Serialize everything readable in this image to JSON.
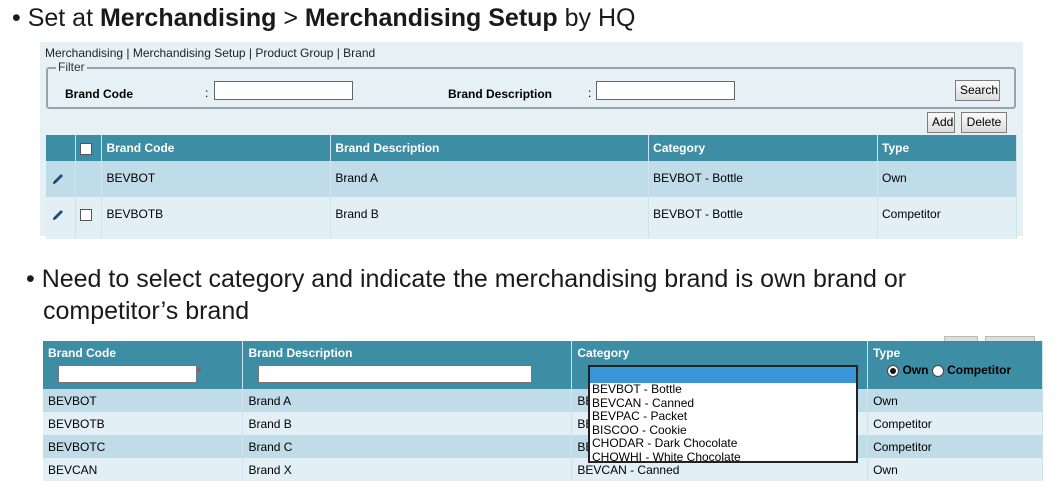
{
  "slide": {
    "bullet1": {
      "prefix": "• Set at ",
      "bold1": "Merchandising",
      "sep": " > ",
      "bold2": "Merchandising Setup",
      "suffix": " by HQ"
    },
    "bullet2_line1": "• Need to select category and indicate the merchandising brand is own brand or",
    "bullet2_line2": "competitor’s brand"
  },
  "screen1": {
    "breadcrumb": "Merchandising | Merchandising Setup | Product Group | Brand",
    "filter": {
      "legend": "Filter",
      "brand_code_label": "Brand Code",
      "brand_desc_label": "Brand Description",
      "colon": ":",
      "brand_code_value": "",
      "brand_desc_value": "",
      "search_label": "Search"
    },
    "actions": {
      "add_label": "Add",
      "delete_label": "Delete"
    },
    "table": {
      "columns": [
        "Brand Code",
        "Brand Description",
        "Category",
        "Type"
      ],
      "rows": [
        {
          "code": "BEVBOT",
          "desc": "Brand A",
          "category": "BEVBOT - Bottle",
          "type": "Own",
          "has_checkbox": false
        },
        {
          "code": "BEVBOTB",
          "desc": "Brand B",
          "category": "BEVBOT - Bottle",
          "type": "Competitor",
          "has_checkbox": true
        }
      ]
    }
  },
  "screen2": {
    "columns": [
      "Brand Code",
      "Brand Description",
      "Category",
      "Type"
    ],
    "type_options": {
      "own": "Own",
      "competitor": "Competitor",
      "selected": "Own"
    },
    "rows": [
      {
        "code": "BEVBOT",
        "desc": "Brand A",
        "category": "BE",
        "type": "Own"
      },
      {
        "code": "BEVBOTB",
        "desc": "Brand B",
        "category": "BE",
        "type": "Competitor"
      },
      {
        "code": "BEVBOTC",
        "desc": "Brand C",
        "category": "BE",
        "type": "Competitor"
      },
      {
        "code": "BEVCAN",
        "desc": "Brand X",
        "category": "BEVCAN - Canned",
        "type": "Own"
      }
    ],
    "category_dropdown": {
      "selected": "",
      "options": [
        "BEVBOT - Bottle",
        "BEVCAN - Canned",
        "BEVPAC - Packet",
        "BISCOO - Cookie",
        "CHODAR - Dark Chocolate",
        "CHOWHI - White Chocolate"
      ]
    },
    "required_mark": "*"
  },
  "colors": {
    "header": "#3d8da4",
    "row_dark": "#bfdce8",
    "row_light": "#e2f0f6",
    "panel_bg": "#e6f1f6",
    "dropdown_highlight": "#3a95d8"
  }
}
